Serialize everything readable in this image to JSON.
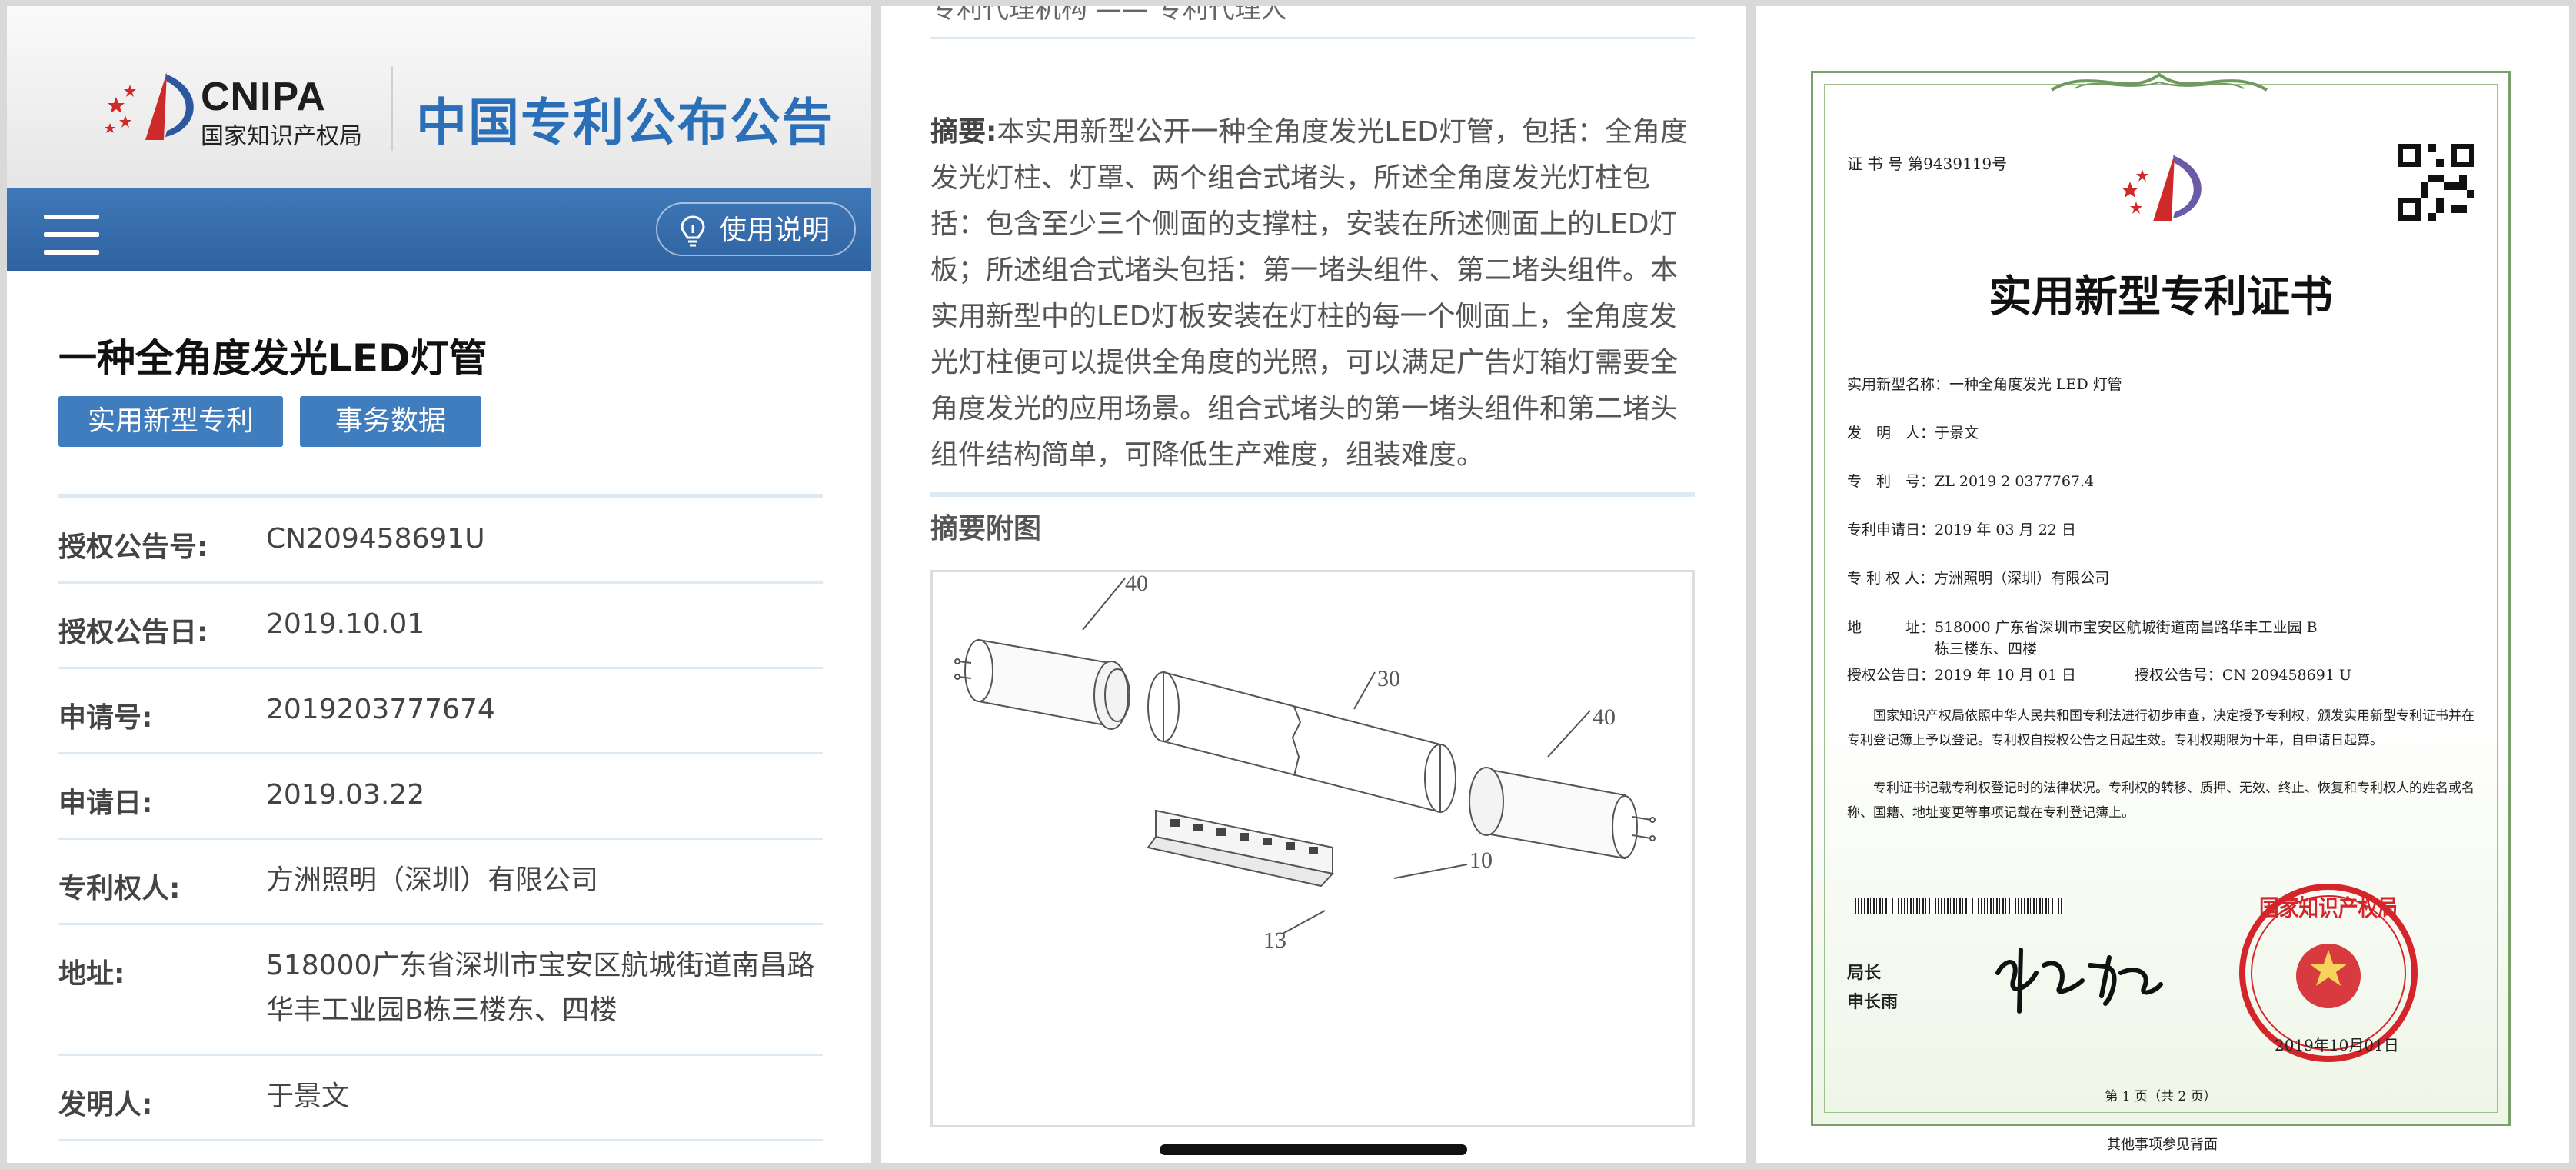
{
  "panel1": {
    "logo": {
      "en": "CNIPA",
      "cn": "国家知识产权局"
    },
    "site_title": "中国专利公布公告",
    "guide_label": "使用说明",
    "patent_title": "一种全角度发光LED灯管",
    "tags": [
      "实用新型专利",
      "事务数据"
    ],
    "info": [
      {
        "label": "授权公告号:",
        "value": "CN209458691U"
      },
      {
        "label": "授权公告日:",
        "value": "2019.10.01"
      },
      {
        "label": "申请号:",
        "value": "2019203777674"
      },
      {
        "label": "申请日:",
        "value": "2019.03.22"
      },
      {
        "label": "专利权人:",
        "value": "方洲照明（深圳）有限公司"
      },
      {
        "label": "地址:",
        "value": "518000广东省深圳市宝安区航城街道南昌路华丰工业园B栋三楼东、四楼"
      },
      {
        "label": "发明人:",
        "value": "于景文"
      }
    ]
  },
  "panel2": {
    "top_cut": "专利代理机构  ——  专利代理人",
    "abstract_label": "摘要:",
    "abstract_text": "本实用新型公开一种全角度发光LED灯管，包括：全角度发光灯柱、灯罩、两个组合式堵头，所述全角度发光灯柱包括：包含至少三个侧面的支撑柱，安装在所述侧面上的LED灯板；所述组合式堵头包括：第一堵头组件、第二堵头组件。本实用新型中的LED灯板安装在灯柱的每一个侧面上，全角度发光灯柱便可以提供全角度的光照，可以满足广告灯箱灯需要全角度发光的应用场景。组合式堵头的第一堵头组件和第二堵头组件结构简单，可降低生产难度，组装难度。",
    "figure_heading": "摘要附图",
    "figure_labels": [
      "40",
      "30",
      "40",
      "10",
      "13"
    ]
  },
  "panel3": {
    "cert_no": "证 书 号 第9439119号",
    "title": "实用新型专利证书",
    "fields": [
      "实用新型名称：一种全角度发光 LED 灯管",
      "发　明　人：于景文",
      "专　利　号：ZL 2019 2 0377767.4",
      "专利申请日：2019 年 03 月 22 日",
      "专 利 权 人：方洲照明（深圳）有限公司",
      "地　　　址：518000 广东省深圳市宝安区航城街道南昌路华丰工业园 B",
      "　　　　　　栋三楼东、四楼",
      "授权公告日：2019 年 10 月 01 日　　　　授权公告号：CN 209458691 U"
    ],
    "paragraphs": [
      "国家知识产权局依照中华人民共和国专利法进行初步审查，决定授予专利权，颁发实用新型专利证书并在专利登记簿上予以登记。专利权自授权公告之日起生效。专利权期限为十年，自申请日起算。",
      "专利证书记载专利权登记时的法律状况。专利权的转移、质押、无效、终止、恢复和专利权人的姓名或名称、国籍、地址变更等事项记载在专利登记簿上。"
    ],
    "signer_title": "局长",
    "signer_name": "申长雨",
    "signature": "申长雨",
    "seal_text": "国家知识产权局",
    "seal_date": "2019年10月01日",
    "page_info": "第 1 页（共 2 页）",
    "footer_note": "其他事项参见背面"
  },
  "colors": {
    "brand_blue": "#2f62a0",
    "tag_blue": "#3f7dbf",
    "title_blue": "#2a6fb7",
    "seal_red": "#d4252b",
    "border_green": "#7aa06c"
  },
  "icons": [
    "menu-icon",
    "lightbulb-icon",
    "cnipa-logo",
    "qr-code",
    "emblem"
  ]
}
